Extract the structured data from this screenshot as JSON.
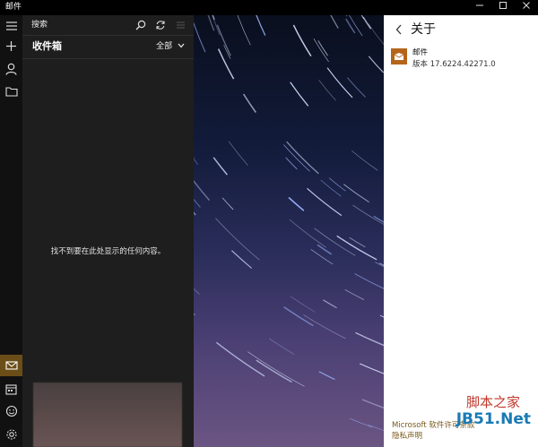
{
  "window": {
    "title": "邮件",
    "minimize_icon": "minimize-icon",
    "maximize_icon": "maximize-icon",
    "close_icon": "close-icon"
  },
  "rail": {
    "items": [
      {
        "name": "menu",
        "icon": "hamburger-icon"
      },
      {
        "name": "new-mail",
        "icon": "plus-icon"
      },
      {
        "name": "accounts",
        "icon": "person-icon"
      },
      {
        "name": "folders",
        "icon": "folder-icon"
      },
      {
        "name": "mail",
        "icon": "mail-icon",
        "active": true
      },
      {
        "name": "calendar",
        "icon": "calendar-icon"
      },
      {
        "name": "people",
        "icon": "smiley-icon"
      },
      {
        "name": "settings",
        "icon": "gear-icon"
      }
    ]
  },
  "search": {
    "placeholder": "搜索"
  },
  "list": {
    "folder_title": "收件箱",
    "filter_label": "全部",
    "empty_message": "找不到要在此处显示的任何内容。"
  },
  "about": {
    "title": "关于",
    "app_name": "邮件",
    "version": "版本 17.6224.42271.0",
    "links": [
      "Microsoft 软件许可条款",
      "隐私声明"
    ]
  },
  "watermark": {
    "line1": "脚本之家",
    "line2": "JB51.Net"
  },
  "colors": {
    "accent": "#6b4d17",
    "link": "#7a5a1a",
    "app_icon": "#b4651a"
  }
}
